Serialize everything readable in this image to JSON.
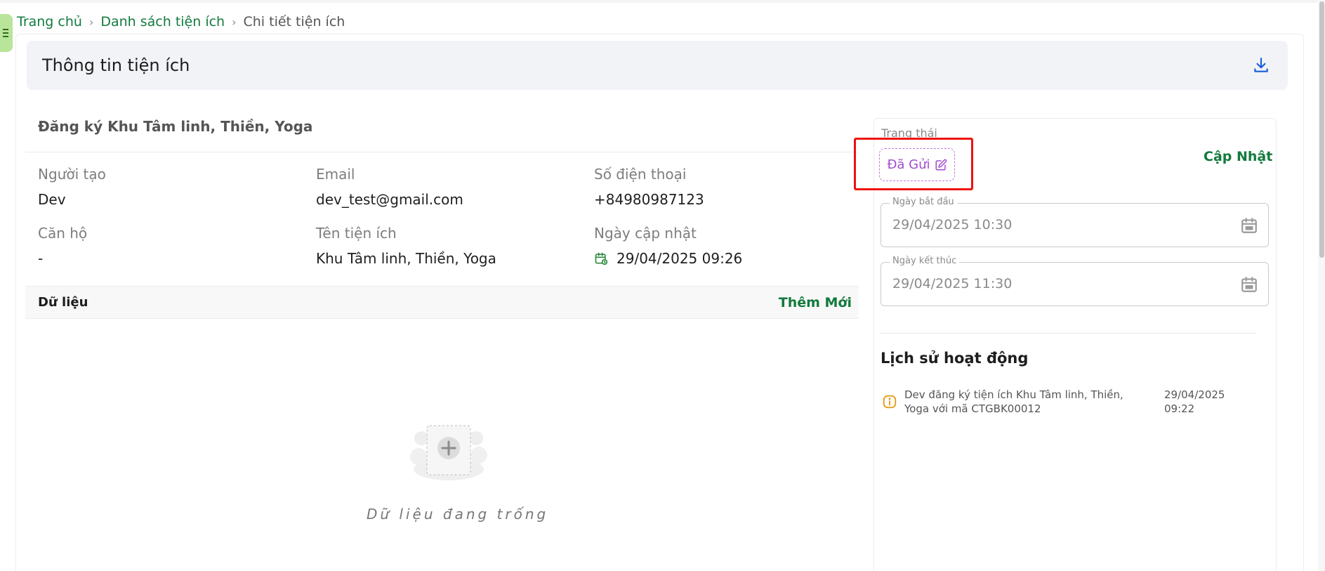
{
  "breadcrumb": {
    "home": "Trang chủ",
    "list": "Danh sách tiện ích",
    "current": "Chi tiết tiện ích",
    "separator": "›"
  },
  "header": {
    "title": "Thông tin tiện ích",
    "download_icon": "download-icon"
  },
  "booking": {
    "title": "Đăng ký Khu Tâm linh, Thiền, Yoga",
    "creator_label": "Người tạo",
    "creator": "Dev",
    "email_label": "Email",
    "email": "dev_test@gmail.com",
    "phone_label": "Số điện thoại",
    "phone": "+84980987123",
    "apartment_label": "Căn hộ",
    "apartment": "-",
    "facility_label": "Tên tiện ích",
    "facility": "Khu Tâm linh, Thiền, Yoga",
    "updated_label": "Ngày cập nhật",
    "updated": "29/04/2025 09:26"
  },
  "data_section": {
    "label": "Dữ liệu",
    "add_label": "Thêm Mới",
    "empty_text": "Dữ liệu đang trống"
  },
  "status": {
    "label": "Trạng thái",
    "value": "Đã Gửi",
    "update_label": "Cập Nhật",
    "badge_color": "#a24bd0"
  },
  "dates": {
    "start_label": "Ngày bắt đầu",
    "start": "29/04/2025 10:30",
    "end_label": "Ngày kết thúc",
    "end": "29/04/2025 11:30"
  },
  "history": {
    "title": "Lịch sử hoạt động",
    "items": [
      {
        "icon": "info-icon",
        "text": "Dev đăng ký tiện ích Khu Tâm linh, Thiền, Yoga với mã CTGBK00012",
        "time": "29/04/2025 09:22"
      }
    ]
  },
  "colors": {
    "accent_green": "#127a3d",
    "header_bg": "#f1f3f7",
    "highlight_red": "#ee1111",
    "download_blue": "#1a5fd6"
  }
}
